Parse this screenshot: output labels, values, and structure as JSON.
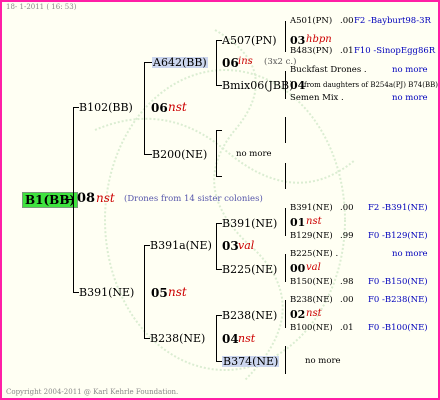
{
  "header": "18-  1-2011 ( 16: 53)",
  "footer": "Copyright 2004-2011 @ Karl Kehrle Foundation.",
  "root": {
    "name": "B1(BB)",
    "gen": "08",
    "mark": "nst",
    "note": "(Drones from 14 sister colonies)"
  },
  "father_side": {
    "name": "B102(BB)",
    "gen": "06",
    "mark": "nst",
    "sire": {
      "name": "A642(BB)",
      "gen": "06",
      "mark": "ins",
      "note": "(3x2 c.)"
    },
    "dam": {
      "name": "B200(NE)",
      "note": "no more"
    },
    "a507": {
      "name": "A507(PN)",
      "gen": "03",
      "mark": "hbpn"
    },
    "bmix": {
      "name": "Bmix06(JBB)",
      "gen": "04",
      "note": "from daughters of B254a(PJ) B74(BB)"
    },
    "a501": {
      "name": "A501(PN)",
      "score": ".00",
      "code": "F2 -Bayburt98-3R"
    },
    "b483": {
      "name": "B483(PN)",
      "score": ".01",
      "code": "F10 -SinopEgg86R"
    },
    "buckfast": {
      "name": "Buckfast Drones .",
      "note": "no more"
    },
    "semen": {
      "name": "Semen Mix .",
      "note": "no more"
    }
  },
  "mother_side": {
    "name": "B391(NE)",
    "gen": "05",
    "mark": "nst",
    "b391a": {
      "name": "B391a(NE)",
      "gen": "03",
      "mark": "val"
    },
    "b238": {
      "name": "B238(NE)",
      "gen": "04",
      "mark": "nst"
    },
    "b391": {
      "name": "B391(NE)",
      "gen": "01",
      "mark": "nst"
    },
    "b225": {
      "name": "B225(NE)",
      "gen": "00",
      "mark": "val"
    },
    "b238b": {
      "name": "B238(NE)",
      "gen": "02",
      "mark": "nst"
    },
    "b374": {
      "name": "B374(NE)",
      "note": "no more"
    },
    "r1": {
      "name": "B391(NE)",
      "score": ".00",
      "code": "F2 -B391(NE)"
    },
    "r2": {
      "name": "B129(NE)",
      "score": ".99",
      "code": "F0 -B129(NE)"
    },
    "r3": {
      "name": "B225(NE) .",
      "note": "no more"
    },
    "r4": {
      "name": "B150(NE)",
      "score": ".98",
      "code": "F0 -B150(NE)"
    },
    "r5": {
      "name": "B238(NE)",
      "score": ".00",
      "code": "F0 -B238(NE)"
    },
    "r6": {
      "name": "B100(NE)",
      "score": ".01",
      "code": "F0 -B100(NE)"
    }
  }
}
